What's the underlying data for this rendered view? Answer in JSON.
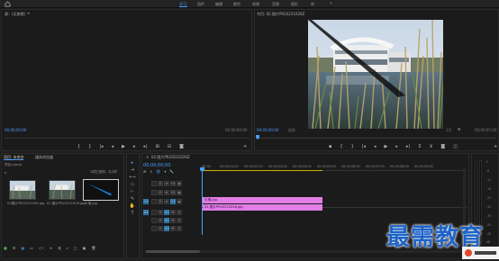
{
  "topbar": {
    "workspaces": [
      {
        "label": "学习",
        "active": true
      },
      {
        "label": "组件",
        "active": false
      },
      {
        "label": "编辑",
        "active": false
      },
      {
        "label": "颜色",
        "active": false
      },
      {
        "label": "效果",
        "active": false
      },
      {
        "label": "音频",
        "active": false
      },
      {
        "label": "图形",
        "active": false
      },
      {
        "label": "库",
        "active": false
      }
    ],
    "more": "»"
  },
  "source": {
    "title": "源：(无剪辑)",
    "timecode_left": "00;00;00;00",
    "timecode_right": "00;00;00;00"
  },
  "program": {
    "title": "节目: 02.图片PR20231026Z",
    "timecode_left": "00;00;00;00",
    "fit": "适合",
    "quality": "完整",
    "timecode_right": "00;00;05;00",
    "zoom": "1/2"
  },
  "project": {
    "tabs": [
      "项目: 未命名",
      "媒体浏览器"
    ],
    "search_label": "项目.prproj",
    "selection_info": "1项已选择，共3项",
    "items": [
      {
        "caption": "01图片PR20231026.jpg"
      },
      {
        "caption": "02.图片PR20231026.jpg"
      },
      {
        "caption": "半鬼.jpg"
      }
    ]
  },
  "timeline": {
    "tab": "02.图片PR20231026Z",
    "timecode": "00;00;00;00",
    "ruler": [
      "00;00",
      "00;00;01;00",
      "00;00;02;00",
      "00;00;03;00",
      "00;00;04;00",
      "00;00;05;00",
      "00;00;06;00",
      "00;00;07;00",
      "00;00;08;00",
      "00;00;09;00"
    ],
    "tracks": [
      {
        "name": "V3"
      },
      {
        "name": "V2"
      },
      {
        "name": "V1"
      },
      {
        "name": "A1"
      },
      {
        "name": "A2"
      },
      {
        "name": "A3"
      }
    ],
    "clips": [
      {
        "label": "半鬼.jpg",
        "color": "#e27ee6"
      },
      {
        "label": "02.图片PR20231026.jpg",
        "color": "#e27ee6"
      }
    ]
  },
  "meter": {
    "scale": [
      "0",
      "-6",
      "-12",
      "-18",
      "-24",
      "-30",
      "-36",
      "-42",
      "-48",
      "dB"
    ]
  },
  "watermark": {
    "text": "最需教育"
  },
  "colors": {
    "accent": "#4a9eff",
    "clip": "#e27ee6",
    "panel": "#1b1b1b"
  }
}
